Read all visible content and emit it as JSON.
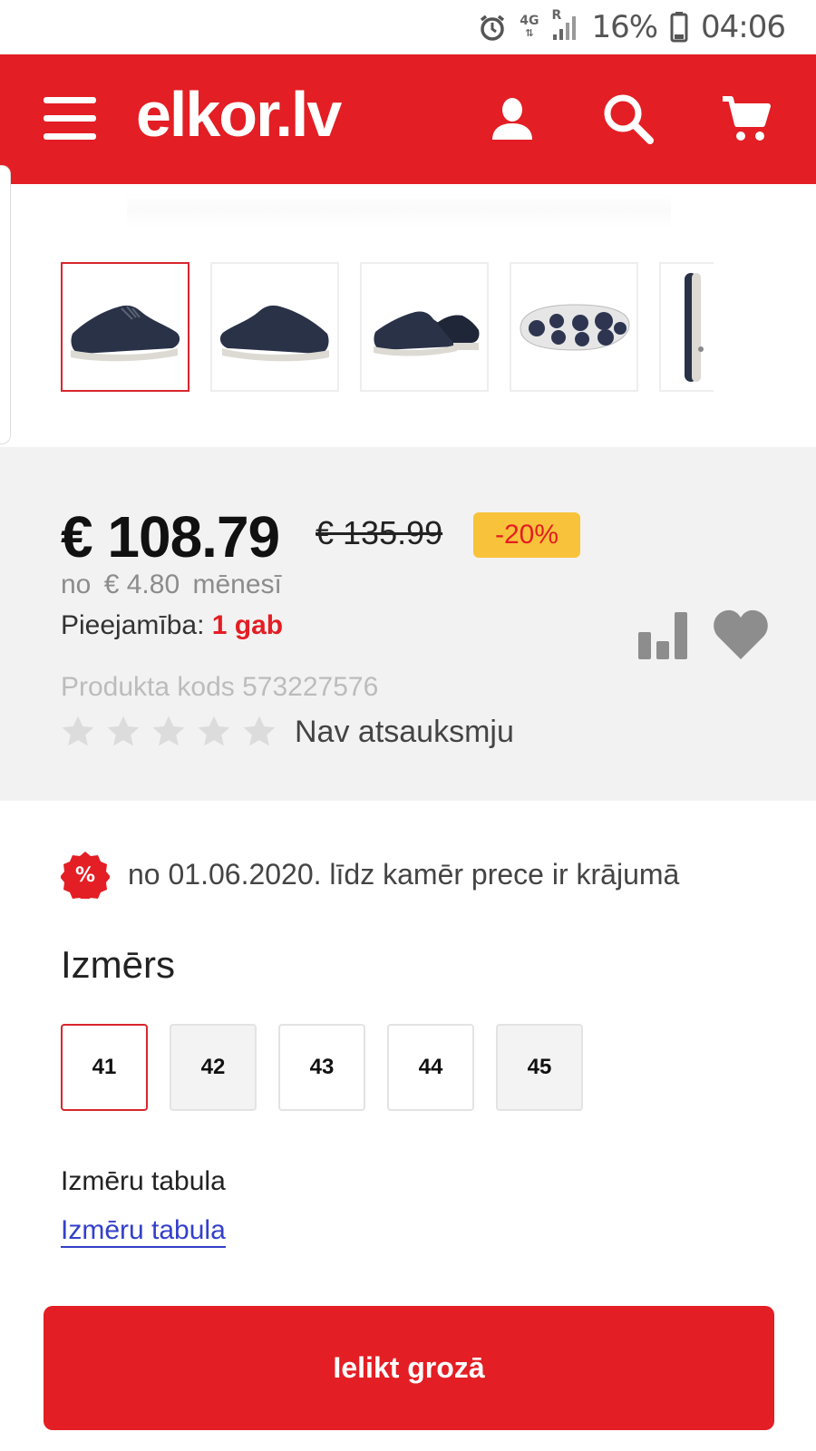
{
  "status_bar": {
    "network": "4G",
    "roaming": "R",
    "battery": "16%",
    "time": "04:06",
    "icons": [
      "alarm-icon",
      "signal-icon",
      "battery-icon"
    ]
  },
  "header": {
    "logo": "elkor.lv",
    "icons": [
      "menu-icon",
      "user-icon",
      "search-icon",
      "cart-icon"
    ],
    "color": "#e31e24"
  },
  "gallery": {
    "thumbnails": [
      {
        "name": "shoe-side-view",
        "active": true
      },
      {
        "name": "shoe-side-view-2",
        "active": false
      },
      {
        "name": "shoe-pair-view",
        "active": false
      },
      {
        "name": "shoe-sole-view",
        "active": false
      },
      {
        "name": "shoe-back-view",
        "active": false
      }
    ]
  },
  "product": {
    "price": "€ 108.79",
    "old_price": "€ 135.99",
    "discount": "-20%",
    "monthly_prefix": "no",
    "monthly_amount": "€ 4.80",
    "monthly_suffix": "mēnesī",
    "availability_label": "Pieejamība:",
    "availability_value": "1 gab",
    "code": "Produkta kods 573227576",
    "rating_stars": 0,
    "reviews": "Nav atsauksmju"
  },
  "promo": {
    "icon": "percent-badge-icon",
    "text": "no 01.06.2020. līdz kamēr prece ir krājumā"
  },
  "sizes": {
    "title": "Izmērs",
    "options": [
      {
        "label": "41",
        "selected": true,
        "available": true
      },
      {
        "label": "42",
        "selected": false,
        "available": false
      },
      {
        "label": "43",
        "selected": false,
        "available": true
      },
      {
        "label": "44",
        "selected": false,
        "available": true
      },
      {
        "label": "45",
        "selected": false,
        "available": false
      }
    ]
  },
  "size_chart": {
    "label": "Izmēru tabula",
    "link": "Izmēru tabula"
  },
  "cart_button": {
    "label": "Ielikt grozā"
  },
  "colors": {
    "brand": "#e31e24",
    "discount_badge": "#f8c33a",
    "link": "#3340c9"
  }
}
